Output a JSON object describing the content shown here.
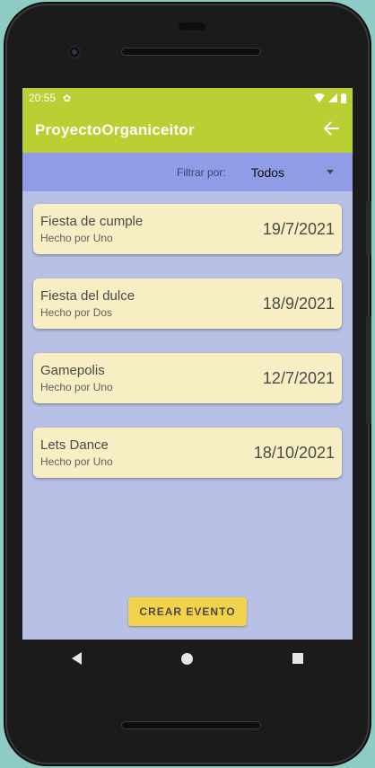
{
  "status_bar": {
    "time": "20:55",
    "settings_icon": "gear-icon",
    "wifi_icon": "wifi-icon",
    "signal_icon": "signal-icon",
    "battery_icon": "battery-icon"
  },
  "app_bar": {
    "title": "ProyectoOrganiceitor",
    "back_icon": "arrow-back-icon",
    "color": "#b9cf33"
  },
  "filter": {
    "label": "Filtrar por:",
    "selected": "Todos",
    "color": "#919ce6"
  },
  "events": [
    {
      "name": "Fiesta de cumple",
      "author": "Hecho por Uno",
      "date": "19/7/2021"
    },
    {
      "name": "Fiesta del dulce",
      "author": "Hecho por Dos",
      "date": "18/9/2021"
    },
    {
      "name": "Gamepolis",
      "author": "Hecho por Uno",
      "date": "12/7/2021"
    },
    {
      "name": "Lets Dance",
      "author": "Hecho por Uno",
      "date": "18/10/2021"
    }
  ],
  "create_button": {
    "label": "CREAR EVENTO",
    "color": "#f1d24a"
  },
  "colors": {
    "screen_background": "#b8c0e5",
    "card_background": "#f7eec3"
  }
}
